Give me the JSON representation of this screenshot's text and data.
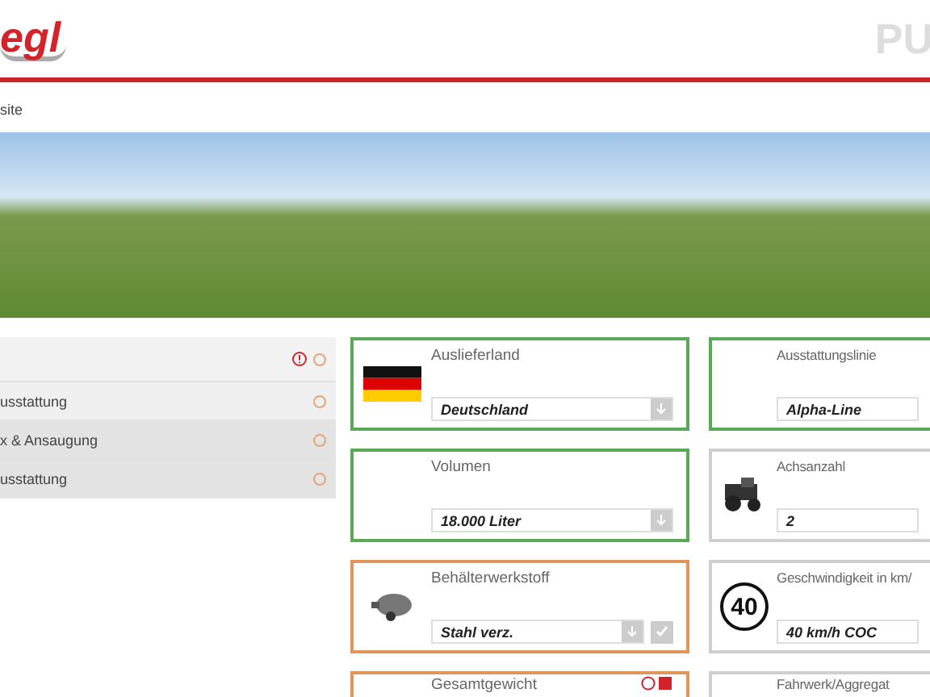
{
  "header": {
    "logo": "egl",
    "title": "PU"
  },
  "breadcrumb": "site",
  "sidebar": {
    "items": [
      {
        "warning": true,
        "done": false
      },
      {
        "label": "usstattung",
        "warning": false,
        "done": false
      },
      {
        "label": "x & Ansaugung",
        "warning": false,
        "done": false
      },
      {
        "label": "usstattung",
        "warning": false,
        "done": false
      }
    ]
  },
  "cards": [
    {
      "title": "Auslieferland",
      "value": "Deutschland",
      "color": "#5aa957",
      "kind": "flag",
      "dropdown": true,
      "confirm": false,
      "warning": false
    },
    {
      "title": "Ausstattungslinie",
      "value": "Alpha-Line",
      "color": "#5aa957",
      "kind": "plain",
      "dropdown": false,
      "confirm": false,
      "warning": false
    },
    {
      "title": "Volumen",
      "value": "18.000 Liter",
      "color": "#5aa957",
      "kind": "plain",
      "dropdown": true,
      "confirm": false,
      "warning": false
    },
    {
      "title": "Achsanzahl",
      "value": "2",
      "color": "#cfcfcf",
      "kind": "machine",
      "dropdown": false,
      "confirm": false,
      "warning": false
    },
    {
      "title": "Behälterwerkstoff",
      "value": "Stahl verz.",
      "color": "#e0955a",
      "kind": "tank",
      "dropdown": true,
      "confirm": true,
      "warning": false
    },
    {
      "title": "Geschwindigkeit in km/",
      "value": "40 km/h COC",
      "color": "#cfcfcf",
      "kind": "sign",
      "sign": "40",
      "dropdown": false,
      "confirm": false,
      "warning": false
    },
    {
      "title": "Gesamtgewicht",
      "color": "#e0955a",
      "kind": "plain",
      "dropdown": false,
      "confirm": false,
      "warning": true
    },
    {
      "title": "Fahrwerk/Aggregat",
      "color": "#cfcfcf",
      "kind": "plain",
      "dropdown": false,
      "confirm": false,
      "warning": false
    }
  ]
}
